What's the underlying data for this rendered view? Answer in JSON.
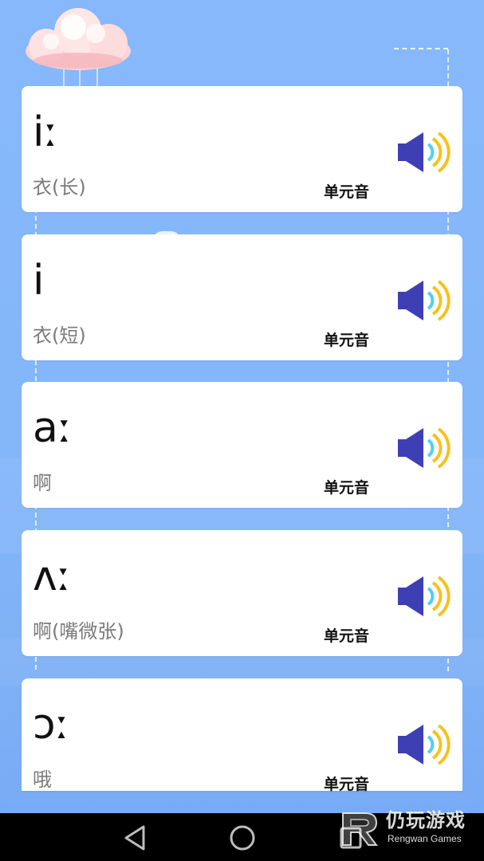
{
  "cards": [
    {
      "symbol": "iː",
      "meaning": "衣(长)",
      "type": "单元音"
    },
    {
      "symbol": "i",
      "meaning": "衣(短)",
      "type": "单元音"
    },
    {
      "symbol": "aː",
      "meaning": "啊",
      "type": "单元音"
    },
    {
      "symbol": "ʌː",
      "meaning": "啊(嘴微张)",
      "type": "单元音"
    },
    {
      "symbol": "ɔː",
      "meaning": "哦",
      "type": "单元音"
    }
  ],
  "icons": {
    "speaker": "speaker-icon",
    "cloud": "cloud-icon",
    "back": "back-triangle-icon",
    "home": "home-circle-icon",
    "recents": "recents-square-icon"
  },
  "watermark": {
    "cn": "仍玩游戏",
    "en": "Rengwan Games"
  },
  "colors": {
    "background": "#86b8fb",
    "card": "#ffffff",
    "speaker_body": "#3f3fb5",
    "speaker_waves": "#f6c21c",
    "speaker_inner_wave": "#4fd1f0",
    "navbar": "#000000"
  }
}
